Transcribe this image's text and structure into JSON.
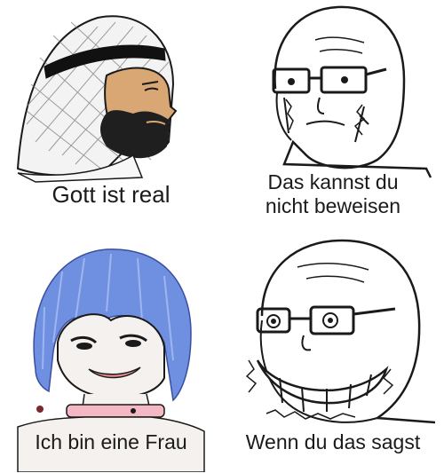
{
  "panels": {
    "top_left": {
      "caption": "Gott ist real"
    },
    "top_right": {
      "caption_line1": "Das kannst du",
      "caption_line2": "nicht beweisen"
    },
    "bottom_left": {
      "caption": "Ich bin eine Frau"
    },
    "bottom_right": {
      "caption": "Wenn du das sagst"
    }
  },
  "colors": {
    "background": "#ffffff",
    "line": "#1a1a1a",
    "skin": "#d9a774",
    "beard": "#1f1f1f",
    "headband": "#111111",
    "hair_blue": "#6f8fe0",
    "hair_light": "#a9c0f5",
    "collar": "#f4b8c4",
    "lips": "#e58a8a"
  }
}
